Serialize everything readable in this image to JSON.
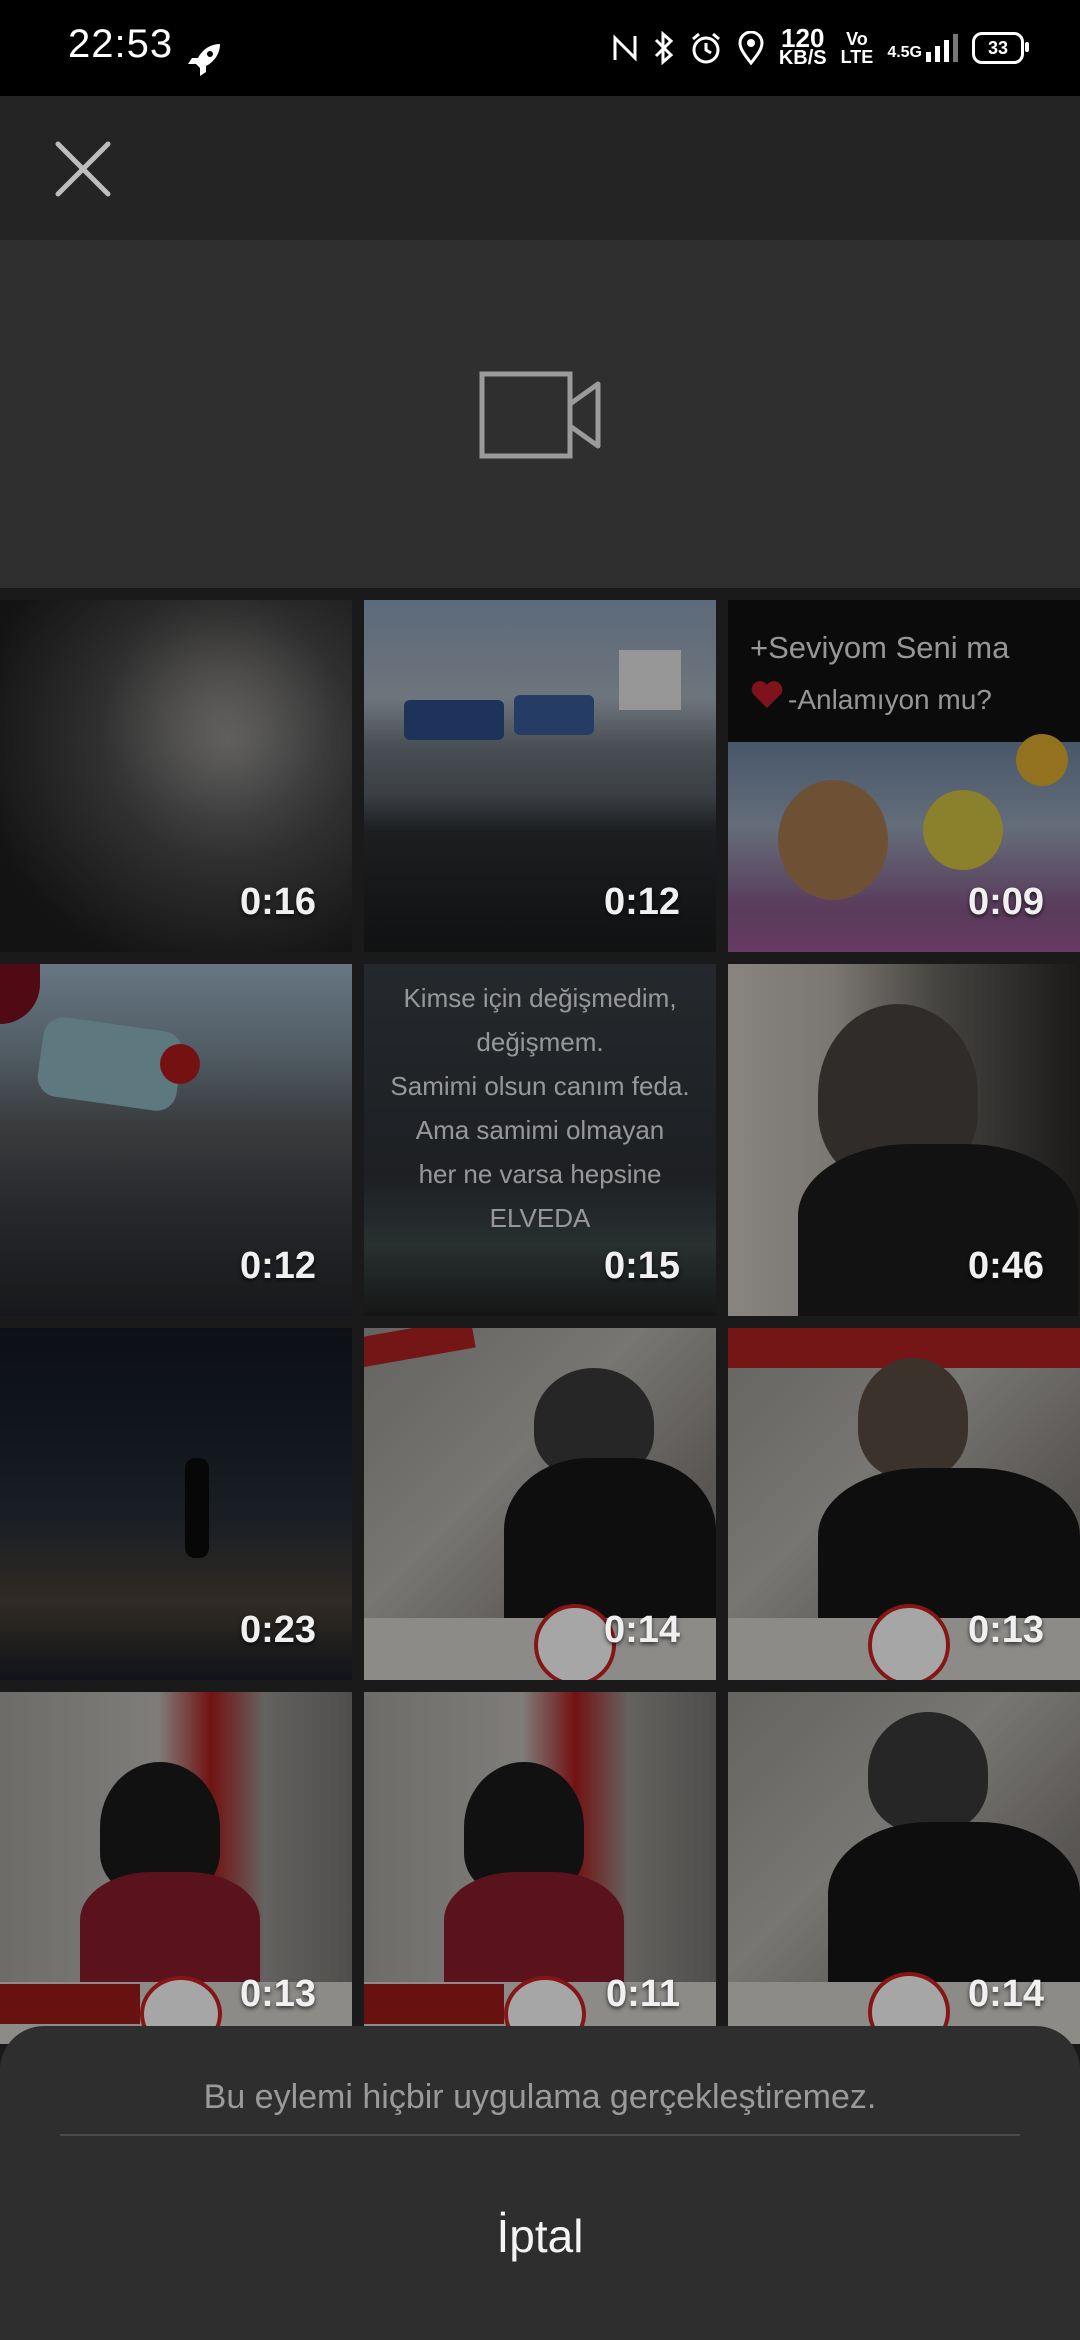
{
  "status_bar": {
    "time": "22:53",
    "speed_value": "120",
    "speed_unit": "KB/S",
    "volte_top": "Vo",
    "volte_bottom": "LTE",
    "network": "4.5G",
    "battery": "33",
    "icons": [
      "rocket-icon",
      "nfc-icon",
      "bluetooth-icon",
      "alarm-icon",
      "location-icon",
      "signal-icon",
      "battery-icon"
    ]
  },
  "top_bar": {
    "close_icon": "close-icon"
  },
  "record": {
    "camera_icon": "video-camera-icon"
  },
  "videos": [
    {
      "duration": "0:16"
    },
    {
      "duration": "0:12"
    },
    {
      "duration": "0:09",
      "caption_line1": "+Seviyom Seni ma",
      "caption_line2": "-Anlamıyon mu?"
    },
    {
      "duration": "0:12"
    },
    {
      "duration": "0:15",
      "caption_lines": [
        "Kimse için değişmedim,",
        "değişmem.",
        "Samimi olsun canım feda.",
        "Ama samimi olmayan",
        "her ne varsa hepsine",
        "ELVEDA"
      ]
    },
    {
      "duration": "0:46"
    },
    {
      "duration": "0:23"
    },
    {
      "duration": "0:14"
    },
    {
      "duration": "0:13"
    },
    {
      "duration": "0:13"
    },
    {
      "duration": "0:11"
    },
    {
      "duration": "0:14"
    }
  ],
  "sheet": {
    "message": "Bu eylemi hiçbir uygulama gerçekleştiremez.",
    "cancel_label": "İptal"
  }
}
